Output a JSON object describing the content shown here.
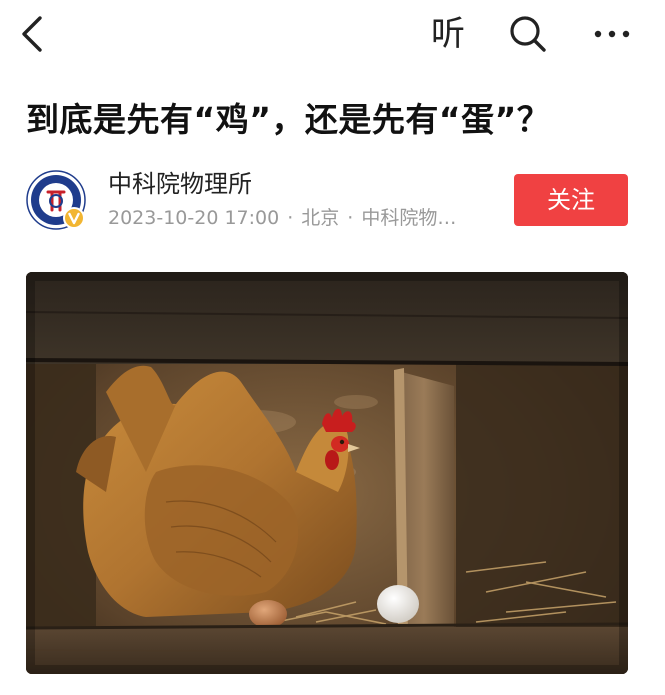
{
  "nav": {
    "back_icon": "chevron-left-icon",
    "listen_label": "听",
    "search_icon": "search-icon",
    "more_icon": "more-dots-icon"
  },
  "article": {
    "title": "到底是先有“鸡”，还是先有“蛋”？",
    "author": {
      "name": "中科院物理所",
      "date": "2023-10-20 17:00",
      "location": "北京",
      "source": "中科院物…",
      "verified": true
    },
    "follow_label": "关注",
    "image": {
      "subject": "hen-with-eggs-photo"
    }
  },
  "colors": {
    "accent": "#f04142",
    "meta": "#999999",
    "title": "#111111"
  }
}
